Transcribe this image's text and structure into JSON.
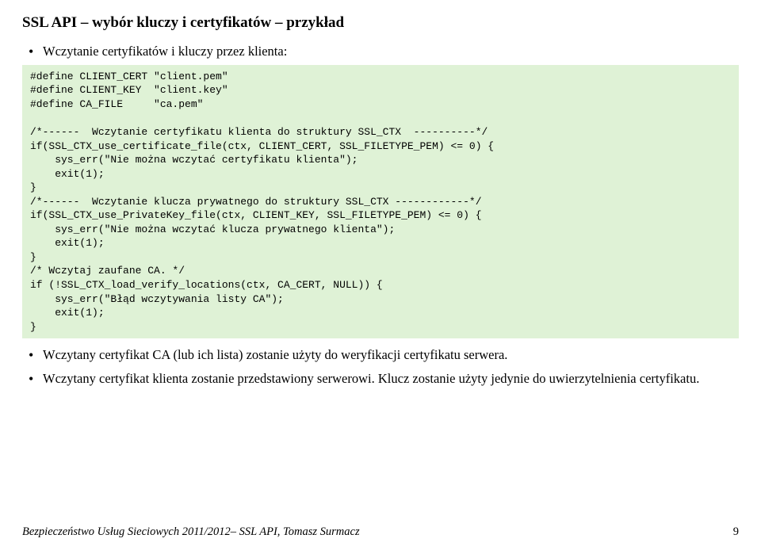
{
  "title": "SSL API – wybór kluczy i certyfikatów – przykład",
  "bullets": {
    "b0": "Wczytanie certyfikatów i kluczy przez klienta:",
    "b1": "Wczytany certyfikat CA (lub ich lista) zostanie użyty do weryfikacji certyfikatu serwera.",
    "b2": "Wczytany certyfikat klienta zostanie przedstawiony serwerowi. Klucz zostanie użyty jedynie do uwierzytelnienia certyfikatu."
  },
  "code": "#define CLIENT_CERT \"client.pem\"\n#define CLIENT_KEY  \"client.key\"\n#define CA_FILE     \"ca.pem\"\n\n/*------  Wczytanie certyfikatu klienta do struktury SSL_CTX  ----------*/\nif(SSL_CTX_use_certificate_file(ctx, CLIENT_CERT, SSL_FILETYPE_PEM) <= 0) {\n    sys_err(\"Nie można wczytać certyfikatu klienta\");\n    exit(1);\n}\n/*------  Wczytanie klucza prywatnego do struktury SSL_CTX ------------*/\nif(SSL_CTX_use_PrivateKey_file(ctx, CLIENT_KEY, SSL_FILETYPE_PEM) <= 0) {\n    sys_err(\"Nie można wczytać klucza prywatnego klienta\");\n    exit(1);\n}\n/* Wczytaj zaufane CA. */\nif (!SSL_CTX_load_verify_locations(ctx, CA_CERT, NULL)) {\n    sys_err(\"Błąd wczytywania listy CA\");\n    exit(1);\n}",
  "footer": {
    "left": "Bezpieczeństwo Usług Sieciowych 2011/2012– SSL API, Tomasz Surmacz",
    "page": "9"
  }
}
